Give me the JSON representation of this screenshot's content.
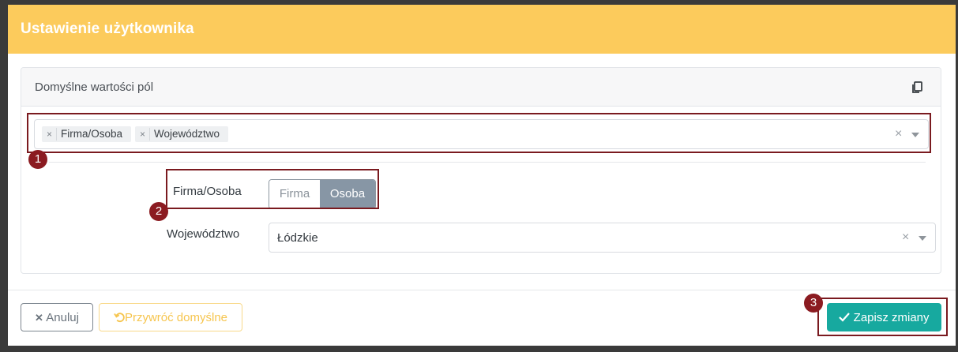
{
  "modal": {
    "title": "Ustawienie użytkownika"
  },
  "card": {
    "title": "Domyślne wartości pól",
    "copy_icon": "copy-icon"
  },
  "fields_select": {
    "tags": [
      {
        "label": "Firma/Osoba",
        "remove": "×"
      },
      {
        "label": "Województwo",
        "remove": "×"
      }
    ],
    "clear": "×"
  },
  "firma_osoba": {
    "label": "Firma/Osoba",
    "options": [
      "Firma",
      "Osoba"
    ],
    "selected": "Osoba"
  },
  "wojewodztwo": {
    "label": "Województwo",
    "value": "Łódzkie",
    "clear": "×"
  },
  "footer": {
    "cancel_icon": "✕",
    "cancel_label": "Anuluj",
    "restore_label": "Przywróć domyślne",
    "save_label": "Zapisz zmiany"
  },
  "annotations": [
    "1",
    "2",
    "3"
  ],
  "colors": {
    "header": "#fccb5c",
    "save": "#17a99f",
    "toggle_active": "#8796a5",
    "annotation": "#8b1b21"
  }
}
